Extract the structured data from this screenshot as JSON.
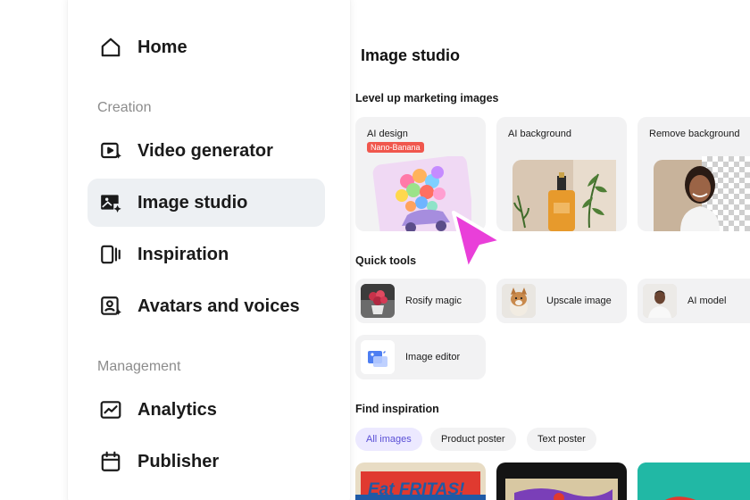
{
  "sidebar": {
    "home": "Home",
    "creation_label": "Creation",
    "items": [
      {
        "label": "Video generator"
      },
      {
        "label": "Image studio"
      },
      {
        "label": "Inspiration"
      },
      {
        "label": "Avatars and voices"
      }
    ],
    "management_label": "Management",
    "management_items": [
      {
        "label": "Analytics"
      },
      {
        "label": "Publisher"
      }
    ]
  },
  "main": {
    "title": "Image studio",
    "feature_section": "Level up marketing images",
    "features": [
      {
        "label": "AI design",
        "badge": "Nano-Banana"
      },
      {
        "label": "AI background"
      },
      {
        "label": "Remove background"
      }
    ],
    "quick_tools_section": "Quick tools",
    "quick_tools": [
      {
        "label": "Rosify magic"
      },
      {
        "label": "Upscale image"
      },
      {
        "label": "AI model"
      },
      {
        "label": "Image editor"
      }
    ],
    "inspiration_section": "Find inspiration",
    "chips": [
      {
        "label": "All images",
        "active": true
      },
      {
        "label": "Product poster"
      },
      {
        "label": "Text poster"
      }
    ],
    "inspiration_cards": [
      {
        "text": "Eat FRITAS!"
      },
      {
        "text": ""
      },
      {
        "text": ""
      }
    ]
  },
  "colors": {
    "active_nav_bg": "#edf0f3",
    "accent_chip": "#ece9ff",
    "badge": "#f0574d",
    "cursor": "#e93fd9"
  }
}
